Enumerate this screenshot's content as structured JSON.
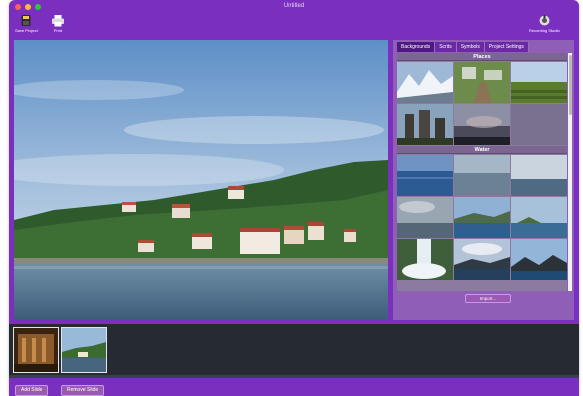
{
  "window": {
    "title": "Untitled"
  },
  "toolbar": {
    "save_label": "Save Project",
    "print_label": "Print",
    "help_label": "Recording Studio"
  },
  "tabs": [
    {
      "label": "Backgrounds",
      "active": true
    },
    {
      "label": "Scrits",
      "active": false
    },
    {
      "label": "Symbols",
      "active": false
    },
    {
      "label": "Project Settings",
      "active": false
    }
  ],
  "library": {
    "sections": [
      {
        "title": "Places",
        "thumbs": [
          "snowy mountains",
          "garden path",
          "vineyard field",
          "castle towers",
          "dusk sky"
        ]
      },
      {
        "title": "Water",
        "thumbs": [
          "blue sea",
          "calm sea",
          "sea horizon",
          "cloudy sea",
          "ocean bay",
          "island sea",
          "waterfall",
          "coastal sunset",
          "mountain lake"
        ]
      }
    ],
    "import_label": "Import..."
  },
  "filmstrip": {
    "slides": [
      "interior scene",
      "coastal village"
    ]
  },
  "bottom": {
    "add_label": "Add Slide",
    "remove_label": "Remove Slide"
  },
  "colors": {
    "window": "#7b2fbf",
    "panel": "#8f5fb8",
    "filmstrip": "#262b33",
    "button": "#9b59b6"
  }
}
